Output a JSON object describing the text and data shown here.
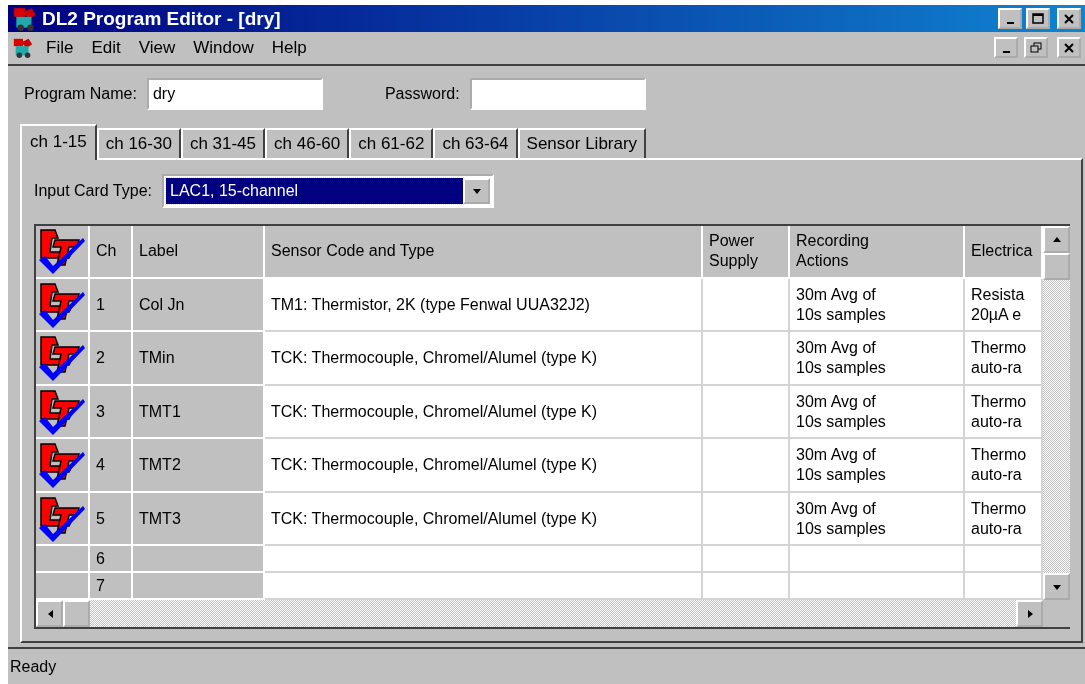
{
  "window": {
    "title": "DL2 Program Editor - [dry]"
  },
  "menu": [
    "File",
    "Edit",
    "View",
    "Window",
    "Help"
  ],
  "program_name": {
    "label": "Program Name:",
    "value": "dry"
  },
  "password": {
    "label": "Password:"
  },
  "tabs": [
    {
      "label": "ch 1-15",
      "selected": true
    },
    {
      "label": "ch 16-30",
      "selected": false
    },
    {
      "label": "ch 31-45",
      "selected": false
    },
    {
      "label": "ch 46-60",
      "selected": false
    },
    {
      "label": "ch 61-62",
      "selected": false
    },
    {
      "label": "ch 63-64",
      "selected": false
    },
    {
      "label": "Sensor Library",
      "selected": false
    }
  ],
  "input_card_type": {
    "label": "Input Card Type:",
    "value": "LAC1, 15-channel"
  },
  "table": {
    "columns": [
      "Ch",
      "Label",
      "Sensor Code and Type",
      "Power\nSupply",
      "Recording\nActions",
      "Electrica"
    ],
    "rows": [
      {
        "configured": true,
        "cells": [
          "1",
          "Col Jn",
          "TM1:  Thermistor, 2K (type Fenwal UUA32J2)",
          "",
          "30m Avg of\n10s samples",
          "Resista\n20µA e"
        ]
      },
      {
        "configured": true,
        "cells": [
          "2",
          "TMin",
          "TCK:  Thermocouple, Chromel/Alumel (type K)",
          "",
          "30m Avg of\n10s samples",
          "Thermo\nauto-ra"
        ]
      },
      {
        "configured": true,
        "cells": [
          "3",
          "TMT1",
          "TCK:  Thermocouple, Chromel/Alumel (type K)",
          "",
          "30m Avg of\n10s samples",
          "Thermo\nauto-ra"
        ]
      },
      {
        "configured": true,
        "cells": [
          "4",
          "TMT2",
          "TCK:  Thermocouple, Chromel/Alumel (type K)",
          "",
          "30m Avg of\n10s samples",
          "Thermo\nauto-ra"
        ]
      },
      {
        "configured": true,
        "cells": [
          "5",
          "TMT3",
          "TCK:  Thermocouple, Chromel/Alumel (type K)",
          "",
          "30m Avg of\n10s samples",
          "Thermo\nauto-ra"
        ]
      },
      {
        "configured": false,
        "cells": [
          "6",
          "",
          "",
          "",
          "",
          ""
        ]
      },
      {
        "configured": false,
        "cells": [
          "7",
          "",
          "",
          "",
          "",
          ""
        ]
      }
    ]
  },
  "status_bar": "Ready"
}
